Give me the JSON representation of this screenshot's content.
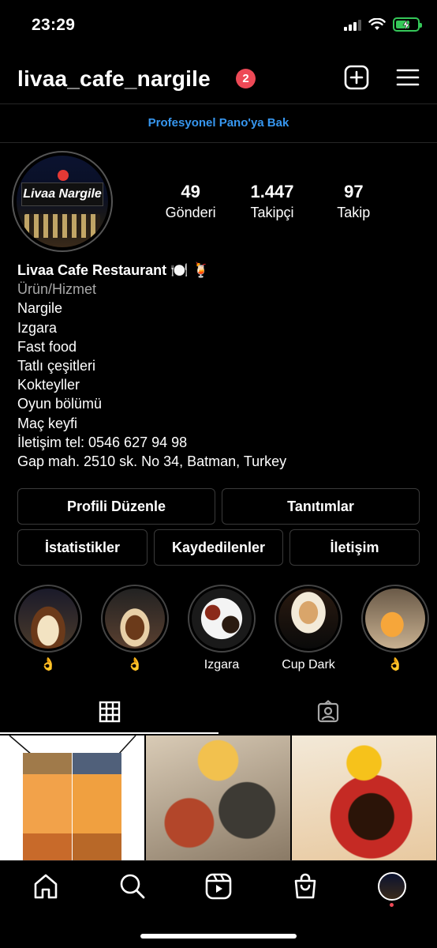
{
  "status_bar": {
    "time": "23:29",
    "battery_state": "charging"
  },
  "header": {
    "username": "livaa_cafe_nargile",
    "notification_count": "2",
    "icons": [
      "plus-square-icon",
      "hamburger-menu-icon"
    ]
  },
  "dashboard_link": "Profesyonel Pano'ya Bak",
  "profile": {
    "avatar_text": "Livaa Nargile",
    "stats": [
      {
        "value": "49",
        "label": "Gönderi"
      },
      {
        "value": "1.447",
        "label": "Takipçi"
      },
      {
        "value": "97",
        "label": "Takip"
      }
    ]
  },
  "bio": {
    "name": "Livaa Cafe Restaurant 🍽️ 🍹",
    "category": "Ürün/Hizmet",
    "lines": [
      "Nargile",
      "Izgara",
      "Fast food",
      "Tatlı çeşitleri",
      "Kokteyller",
      "Oyun bölümü",
      "Maç keyfi",
      "İletişim tel: 0546 627 94 98",
      "Gap mah. 2510 sk. No 34, Batman, Turkey"
    ]
  },
  "buttons": {
    "edit_profile": "Profili Düzenle",
    "promotions": "Tanıtımlar",
    "insights": "İstatistikler",
    "saved": "Kaydedilenler",
    "contact": "İletişim"
  },
  "highlights": [
    {
      "label": "👌"
    },
    {
      "label": "👌"
    },
    {
      "label": "Izgara"
    },
    {
      "label": "Cup Dark"
    },
    {
      "label": "👌"
    }
  ],
  "tabs": {
    "active": "grid",
    "items": [
      "grid-icon",
      "tagged-icon"
    ]
  },
  "bottom_nav": [
    "home-icon",
    "search-icon",
    "reels-icon",
    "shop-icon",
    "profile-avatar"
  ],
  "colors": {
    "accent_link": "#3797f0",
    "badge": "#ed4956",
    "battery": "#35c759"
  }
}
